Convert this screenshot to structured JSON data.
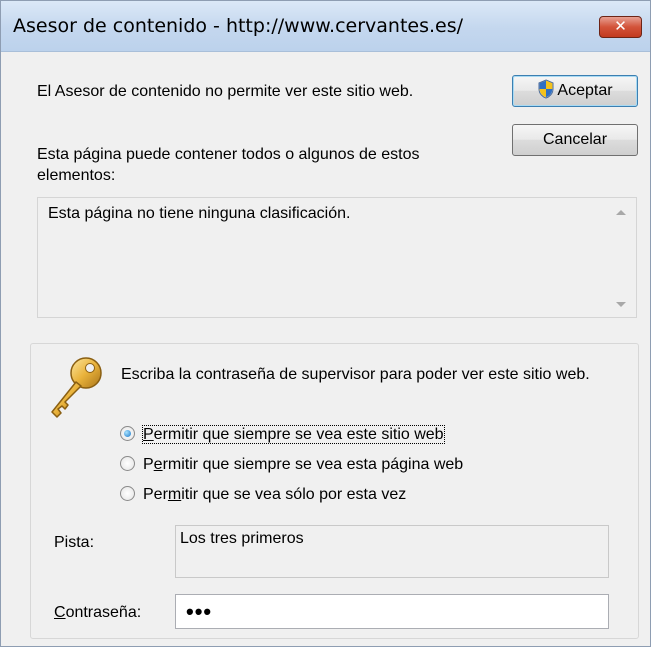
{
  "window": {
    "title": "Asesor de contenido - http://www.cervantes.es/",
    "close_glyph": "✕"
  },
  "message": "El Asesor de contenido no permite ver este sitio web.",
  "buttons": {
    "accept": "Aceptar",
    "cancel": "Cancelar"
  },
  "elements_label": "Esta página puede contener todos o algunos de estos elementos:",
  "rating_text": "Esta página no tiene ninguna clasificación.",
  "supervisor": {
    "instruction": "Escriba la contraseña de supervisor para poder ver este sitio web.",
    "options": [
      {
        "pre": "",
        "u": "P",
        "post": "ermitir que siempre se vea este sitio web",
        "checked": true
      },
      {
        "pre": "P",
        "u": "e",
        "post": "rmitir que siempre se vea esta página web",
        "checked": false
      },
      {
        "pre": "Per",
        "u": "m",
        "post": "itir que se vea sólo por esta vez",
        "checked": false
      }
    ],
    "hint_label": "Pista:",
    "hint_value": "Los tres primeros",
    "password_label": {
      "pre": "",
      "u": "C",
      "post": "ontraseña:"
    },
    "password_value": "•••"
  },
  "icons": {
    "shield": "uac-shield-icon",
    "key": "key-icon"
  }
}
